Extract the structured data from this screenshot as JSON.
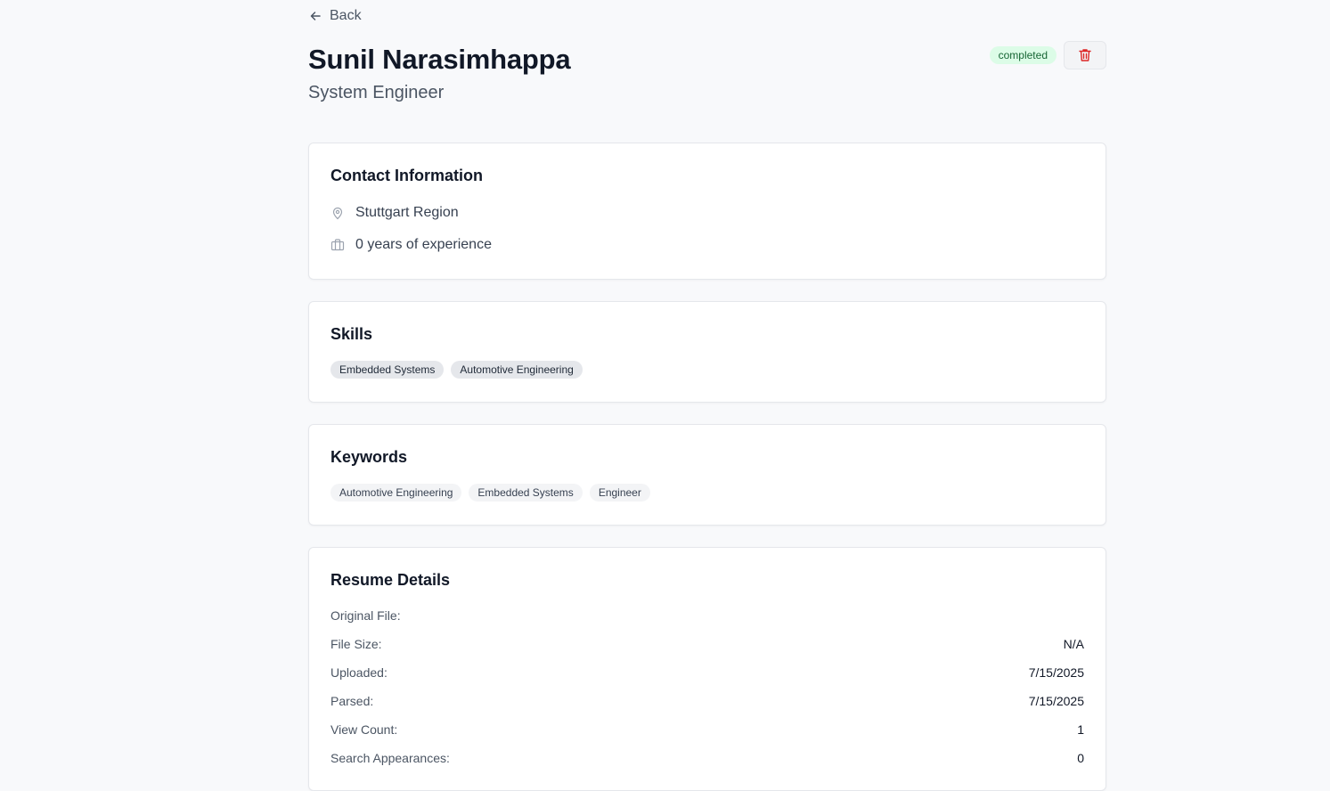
{
  "nav": {
    "back_label": "Back"
  },
  "profile": {
    "name": "Sunil Narasimhappa",
    "role": "System Engineer",
    "status": "completed",
    "status_color": "#dcfce7",
    "status_text_color": "#166534",
    "delete_icon": "trash-icon",
    "delete_color": "#dc2626"
  },
  "contact": {
    "title": "Contact Information",
    "items": [
      {
        "icon": "map-pin-icon",
        "text": "Stuttgart Region"
      },
      {
        "icon": "briefcase-icon",
        "text": "0 years of experience"
      }
    ]
  },
  "skills": {
    "title": "Skills",
    "items": [
      "Embedded Systems",
      "Automotive Engineering"
    ]
  },
  "keywords": {
    "title": "Keywords",
    "items": [
      "Automotive Engineering",
      "Embedded Systems",
      "Engineer"
    ]
  },
  "resume": {
    "title": "Resume Details",
    "rows": [
      {
        "label": "Original File:",
        "value": ""
      },
      {
        "label": "File Size:",
        "value": "N/A"
      },
      {
        "label": "Uploaded:",
        "value": "7/15/2025"
      },
      {
        "label": "Parsed:",
        "value": "7/15/2025"
      },
      {
        "label": "View Count:",
        "value": "1"
      },
      {
        "label": "Search Appearances:",
        "value": "0"
      }
    ]
  }
}
